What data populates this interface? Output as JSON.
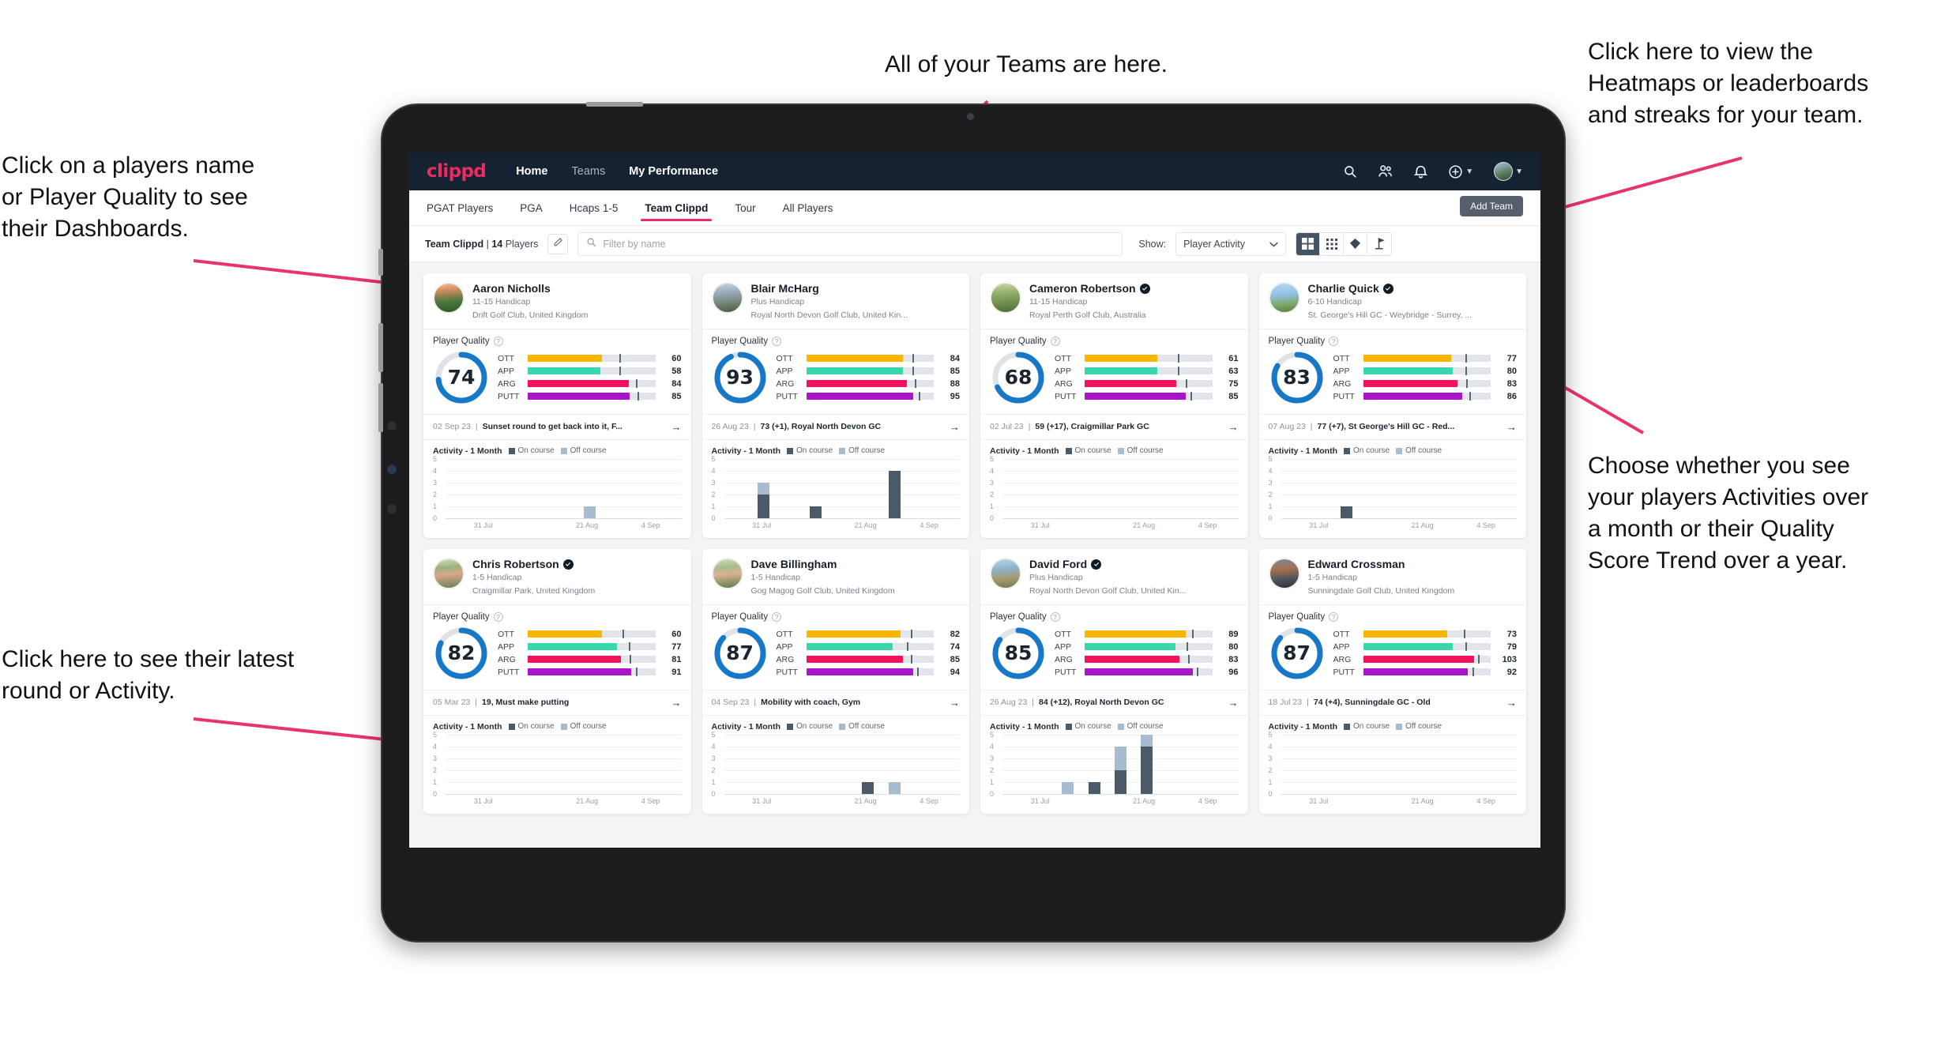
{
  "annotations": {
    "left_top": "Click on a players name\nor Player Quality to see\ntheir Dashboards.",
    "left_bottom": "Click here to see their latest\nround or Activity.",
    "top": "All of your Teams are here.",
    "right_top": "Click here to view the\nHeatmaps or leaderboards\nand streaks for your team.",
    "right_bottom": "Choose whether you see\nyour players Activities over\na month or their Quality\nScore Trend over a year."
  },
  "colors": {
    "brand_pink": "#ee2a62",
    "nav_dark": "#152232",
    "ring_blue": "#1878c8",
    "ott": "#f7b500",
    "app": "#3ad6b0",
    "arg": "#f4115e",
    "putt": "#a915cb",
    "on_course": "#4a5a68",
    "off_course": "#a7bccf"
  },
  "topnav": {
    "brand": "clippd",
    "links": [
      {
        "label": "Home",
        "active": true
      },
      {
        "label": "Teams",
        "active": false
      },
      {
        "label": "My Performance",
        "active": true
      }
    ],
    "icons": [
      "search-icon",
      "people-icon",
      "bell-icon",
      "plus-circle-icon",
      "avatar"
    ]
  },
  "tabs": [
    {
      "label": "PGAT Players",
      "active": false
    },
    {
      "label": "PGA",
      "active": false
    },
    {
      "label": "Hcaps 1-5",
      "active": false
    },
    {
      "label": "Team Clippd",
      "active": true
    },
    {
      "label": "Tour",
      "active": false
    },
    {
      "label": "All Players",
      "active": false
    }
  ],
  "add_team_button": "Add Team",
  "filterbar": {
    "team_name": "Team Clippd",
    "separator": "|",
    "player_count": "14",
    "players_word": "Players",
    "edit_icon": "pencil-icon",
    "search_placeholder": "Filter by name",
    "search_value": "",
    "show_label": "Show:",
    "show_value": "Player Activity",
    "show_options": [
      "Player Activity",
      "Quality Score Trend"
    ],
    "view_toggles": [
      {
        "icon": "grid-large-icon",
        "active": true
      },
      {
        "icon": "grid-small-icon",
        "active": false
      },
      {
        "icon": "heatmap-icon",
        "active": false
      },
      {
        "icon": "leaderboard-icon",
        "active": false
      }
    ]
  },
  "card_labels": {
    "player_quality": "Player Quality",
    "help_icon": "question-icon",
    "activity_title": "Activity - 1 Month",
    "legend_on": "On course",
    "legend_off": "Off course",
    "arrow": "→"
  },
  "chart_data": {
    "type": "bar",
    "title": "Activity - 1 Month",
    "ylim": [
      0,
      5
    ],
    "yticks": [
      0,
      1,
      2,
      3,
      4,
      5
    ],
    "xlabel": "",
    "ylabel": "",
    "xticks": [
      "31 Jul",
      "21 Aug",
      "4 Sep"
    ],
    "grid": true,
    "legend": [
      "On course",
      "Off course"
    ],
    "legend_position": "top",
    "stacked": true,
    "bins": 9,
    "charts": [
      {
        "player": "Aaron Nicholls",
        "on_course": [
          0,
          0,
          0,
          0,
          0,
          0,
          1,
          0,
          0
        ],
        "off_course": [
          0,
          0,
          0,
          0,
          0,
          0,
          0,
          0,
          0
        ],
        "note": "single off-course bar of 1 near 21 Aug"
      },
      {
        "player": "Blair McHarg",
        "on_course": [
          0,
          2,
          0,
          1,
          0,
          0,
          4,
          0,
          0
        ],
        "off_course": [
          0,
          1,
          0,
          0,
          0,
          0,
          0,
          0,
          0
        ]
      },
      {
        "player": "Cameron Robertson",
        "on_course": [
          0,
          0,
          0,
          0,
          0,
          0,
          0,
          0,
          0
        ],
        "off_course": [
          0,
          0,
          0,
          0,
          0,
          0,
          0,
          0,
          0
        ]
      },
      {
        "player": "Charlie Quick",
        "on_course": [
          0,
          0,
          1,
          0,
          0,
          0,
          0,
          0,
          0
        ],
        "off_course": [
          0,
          0,
          0,
          0,
          0,
          0,
          0,
          0,
          0
        ]
      },
      {
        "player": "Chris Robertson",
        "on_course": [
          0,
          0,
          0,
          0,
          0,
          0,
          0,
          0,
          0
        ],
        "off_course": [
          0,
          0,
          0,
          0,
          0,
          0,
          0,
          0,
          0
        ]
      },
      {
        "player": "Dave Billingham",
        "on_course": [
          0,
          0,
          0,
          0,
          0,
          1,
          0,
          0,
          0
        ],
        "off_course": [
          0,
          0,
          0,
          0,
          0,
          0,
          1,
          0,
          0
        ]
      },
      {
        "player": "David Ford",
        "on_course": [
          0,
          0,
          0,
          1,
          2,
          4,
          0,
          0,
          0
        ],
        "off_course": [
          0,
          0,
          1,
          0,
          2,
          1,
          0,
          0,
          0
        ]
      },
      {
        "player": "Edward Crossman",
        "on_course": [
          0,
          0,
          0,
          0,
          0,
          0,
          0,
          0,
          0
        ],
        "off_course": [
          0,
          0,
          0,
          0,
          0,
          0,
          0,
          0,
          0
        ]
      }
    ]
  },
  "players": [
    {
      "name": "Aaron Nicholls",
      "verified": false,
      "avatar": "av1",
      "handicap": "11-15 Handicap",
      "club": "Drift Golf Club, United Kingdom",
      "quality": 74,
      "metrics": [
        {
          "label": "OTT",
          "value": 60,
          "fill": 58,
          "tick": 72,
          "color": "#f7b500"
        },
        {
          "label": "APP",
          "value": 58,
          "fill": 57,
          "tick": 72,
          "color": "#3ad6b0"
        },
        {
          "label": "ARG",
          "value": 84,
          "fill": 79,
          "tick": 85,
          "color": "#f4115e"
        },
        {
          "label": "PUTT",
          "value": 85,
          "fill": 80,
          "tick": 86,
          "color": "#a915cb"
        }
      ],
      "round_date": "02 Sep 23",
      "round_text": "Sunset round to get back into it, F..."
    },
    {
      "name": "Blair McHarg",
      "verified": false,
      "avatar": "av2",
      "handicap": "Plus Handicap",
      "club": "Royal North Devon Golf Club, United Kin...",
      "quality": 93,
      "metrics": [
        {
          "label": "OTT",
          "value": 84,
          "fill": 76,
          "tick": 83,
          "color": "#f7b500"
        },
        {
          "label": "APP",
          "value": 85,
          "fill": 76,
          "tick": 83,
          "color": "#3ad6b0"
        },
        {
          "label": "ARG",
          "value": 88,
          "fill": 79,
          "tick": 85,
          "color": "#f4115e"
        },
        {
          "label": "PUTT",
          "value": 95,
          "fill": 84,
          "tick": 88,
          "color": "#a915cb"
        }
      ],
      "round_date": "26 Aug 23",
      "round_text": "73 (+1), Royal North Devon GC"
    },
    {
      "name": "Cameron Robertson",
      "verified": true,
      "avatar": "av3",
      "handicap": "11-15 Handicap",
      "club": "Royal Perth Golf Club, Australia",
      "quality": 68,
      "metrics": [
        {
          "label": "OTT",
          "value": 61,
          "fill": 57,
          "tick": 73,
          "color": "#f7b500"
        },
        {
          "label": "APP",
          "value": 63,
          "fill": 57,
          "tick": 73,
          "color": "#3ad6b0"
        },
        {
          "label": "ARG",
          "value": 75,
          "fill": 72,
          "tick": 79,
          "color": "#f4115e"
        },
        {
          "label": "PUTT",
          "value": 85,
          "fill": 79,
          "tick": 83,
          "color": "#a915cb"
        }
      ],
      "round_date": "02 Jul 23",
      "round_text": "59 (+17), Craigmillar Park GC"
    },
    {
      "name": "Charlie Quick",
      "verified": true,
      "avatar": "av4",
      "handicap": "6-10 Handicap",
      "club": "St. George's Hill GC - Weybridge - Surrey, ...",
      "quality": 83,
      "metrics": [
        {
          "label": "OTT",
          "value": 77,
          "fill": 69,
          "tick": 80,
          "color": "#f7b500"
        },
        {
          "label": "APP",
          "value": 80,
          "fill": 70,
          "tick": 80,
          "color": "#3ad6b0"
        },
        {
          "label": "ARG",
          "value": 83,
          "fill": 74,
          "tick": 81,
          "color": "#f4115e"
        },
        {
          "label": "PUTT",
          "value": 86,
          "fill": 78,
          "tick": 83,
          "color": "#a915cb"
        }
      ],
      "round_date": "07 Aug 23",
      "round_text": "77 (+7), St George's Hill GC - Red..."
    },
    {
      "name": "Chris Robertson",
      "verified": true,
      "avatar": "av5",
      "handicap": "1-5 Handicap",
      "club": "Craigmillar Park, United Kingdom",
      "quality": 82,
      "metrics": [
        {
          "label": "OTT",
          "value": 60,
          "fill": 58,
          "tick": 74,
          "color": "#f7b500"
        },
        {
          "label": "APP",
          "value": 77,
          "fill": 70,
          "tick": 79,
          "color": "#3ad6b0"
        },
        {
          "label": "ARG",
          "value": 81,
          "fill": 73,
          "tick": 80,
          "color": "#f4115e"
        },
        {
          "label": "PUTT",
          "value": 91,
          "fill": 81,
          "tick": 85,
          "color": "#a915cb"
        }
      ],
      "round_date": "05 Mar 23",
      "round_text": "19, Must make putting"
    },
    {
      "name": "Dave Billingham",
      "verified": false,
      "avatar": "av6",
      "handicap": "1-5 Handicap",
      "club": "Gog Magog Golf Club, United Kingdom",
      "quality": 87,
      "metrics": [
        {
          "label": "OTT",
          "value": 82,
          "fill": 74,
          "tick": 82,
          "color": "#f7b500"
        },
        {
          "label": "APP",
          "value": 74,
          "fill": 68,
          "tick": 79,
          "color": "#3ad6b0"
        },
        {
          "label": "ARG",
          "value": 85,
          "fill": 76,
          "tick": 82,
          "color": "#f4115e"
        },
        {
          "label": "PUTT",
          "value": 94,
          "fill": 84,
          "tick": 87,
          "color": "#a915cb"
        }
      ],
      "round_date": "04 Sep 23",
      "round_text": "Mobility with coach, Gym"
    },
    {
      "name": "David Ford",
      "verified": true,
      "avatar": "av7",
      "handicap": "Plus Handicap",
      "club": "Royal North Devon Golf Club, United Kin...",
      "quality": 85,
      "metrics": [
        {
          "label": "OTT",
          "value": 89,
          "fill": 79,
          "tick": 84,
          "color": "#f7b500"
        },
        {
          "label": "APP",
          "value": 80,
          "fill": 71,
          "tick": 80,
          "color": "#3ad6b0"
        },
        {
          "label": "ARG",
          "value": 83,
          "fill": 74,
          "tick": 81,
          "color": "#f4115e"
        },
        {
          "label": "PUTT",
          "value": 96,
          "fill": 85,
          "tick": 88,
          "color": "#a915cb"
        }
      ],
      "round_date": "26 Aug 23",
      "round_text": "84 (+12), Royal North Devon GC"
    },
    {
      "name": "Edward Crossman",
      "verified": false,
      "avatar": "av8",
      "handicap": "1-5 Handicap",
      "club": "Sunningdale Golf Club, United Kingdom",
      "quality": 87,
      "metrics": [
        {
          "label": "OTT",
          "value": 73,
          "fill": 66,
          "tick": 79,
          "color": "#f7b500"
        },
        {
          "label": "APP",
          "value": 79,
          "fill": 70,
          "tick": 80,
          "color": "#3ad6b0"
        },
        {
          "label": "ARG",
          "value": 103,
          "fill": 87,
          "tick": 90,
          "color": "#f4115e"
        },
        {
          "label": "PUTT",
          "value": 92,
          "fill": 82,
          "tick": 86,
          "color": "#a915cb"
        }
      ],
      "round_date": "18 Jul 23",
      "round_text": "74 (+4), Sunningdale GC - Old"
    }
  ]
}
